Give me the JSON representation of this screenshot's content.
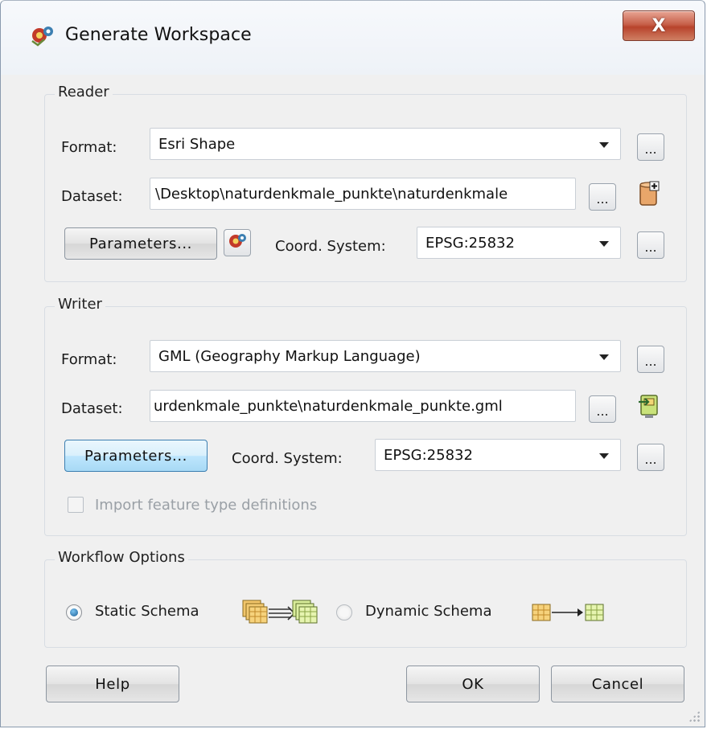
{
  "window": {
    "title": "Generate Workspace",
    "close_label": "X"
  },
  "reader": {
    "legend": "Reader",
    "format_label": "Format:",
    "format_value": "Esri Shape",
    "dataset_label": "Dataset:",
    "dataset_value": "\\Desktop\\naturdenkmale_punkte\\naturdenkmale",
    "parameters_label": "Parameters...",
    "coord_label": "Coord. System:",
    "coord_value": "EPSG:25832",
    "browse_label": "..."
  },
  "writer": {
    "legend": "Writer",
    "format_label": "Format:",
    "format_value": "GML (Geography Markup Language)",
    "dataset_label": "Dataset:",
    "dataset_value": "urdenkmale_punkte\\naturdenkmale_punkte.gml",
    "parameters_label": "Parameters...",
    "coord_label": "Coord. System:",
    "coord_value": "EPSG:25832",
    "browse_label": "...",
    "import_label": "Import feature type definitions",
    "import_checked": false
  },
  "workflow": {
    "legend": "Workflow Options",
    "static_label": "Static Schema",
    "dynamic_label": "Dynamic Schema",
    "selected": "static"
  },
  "footer": {
    "help_label": "Help",
    "ok_label": "OK",
    "cancel_label": "Cancel"
  },
  "colors": {
    "accent": "#3c7fb1",
    "close": "#c7604a",
    "table_icon": "#e8b84a"
  },
  "icons": {
    "title": "workspace-gear-icon",
    "reader_db": "database-add-icon",
    "reader_coord": "globe-gear-icon",
    "writer_export": "export-dataset-icon",
    "static_schema": "static-schema-icon",
    "dynamic_schema": "dynamic-schema-icon"
  }
}
